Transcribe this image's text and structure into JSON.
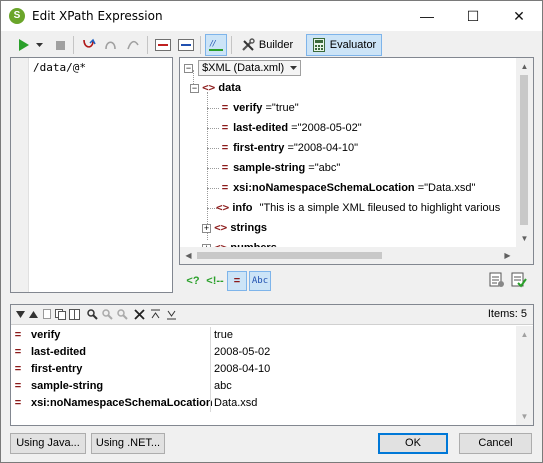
{
  "window": {
    "title": "Edit XPath Expression",
    "app_icon_glyph": "S",
    "controls": {
      "minimize": "—",
      "maximize": "☐",
      "close": "✕"
    }
  },
  "toolbar": {
    "builder_label": "Builder",
    "evaluator_label": "Evaluator"
  },
  "expression": {
    "value": "/data/@*"
  },
  "tree": {
    "source_select": "$XML (Data.xml)",
    "root": {
      "name": "data"
    },
    "attributes": [
      {
        "name": "verify",
        "value": "\"true\""
      },
      {
        "name": "last-edited",
        "value": "\"2008-05-02\""
      },
      {
        "name": "first-entry",
        "value": "\"2008-04-10\""
      },
      {
        "name": "sample-string",
        "value": "\"abc\""
      },
      {
        "name": "xsi:noNamespaceSchemaLocation",
        "value": "\"Data.xsd\""
      }
    ],
    "info_node": {
      "name": "info",
      "text": "\"This is a simple XML fileused to highlight various"
    },
    "collapsed_nodes": [
      {
        "name": "strings"
      },
      {
        "name": "numbers"
      }
    ],
    "mid_toolbar": {
      "pi_label": "<?",
      "comment_label": "<!--",
      "attr_label": "=",
      "text_label": "Abc"
    }
  },
  "results": {
    "items_label": "Items: 5",
    "rows": [
      {
        "name": "verify",
        "value": "true"
      },
      {
        "name": "last-edited",
        "value": "2008-05-02"
      },
      {
        "name": "first-entry",
        "value": "2008-04-10"
      },
      {
        "name": "sample-string",
        "value": "abc"
      },
      {
        "name": "xsi:noNamespaceSchemaLocation",
        "value": "Data.xsd"
      }
    ]
  },
  "buttons": {
    "using_java": "Using Java...",
    "using_net": "Using .NET...",
    "ok": "OK",
    "cancel": "Cancel"
  },
  "colors": {
    "accent": "#0078d7",
    "node_marker": "#8b1a1a",
    "run_green": "#2aa02a"
  }
}
